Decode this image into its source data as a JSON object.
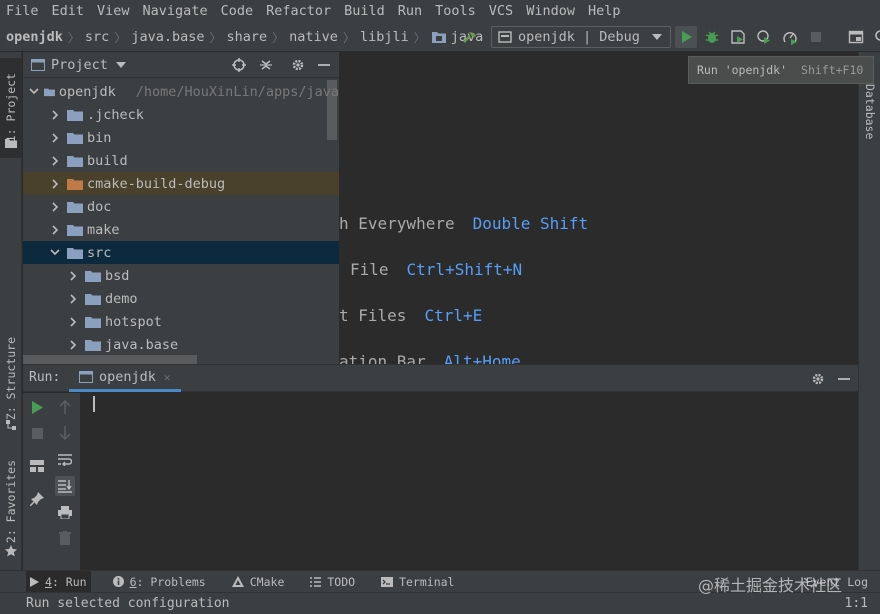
{
  "colors": {
    "accent": "#4a88c7",
    "run_green": "#499c54",
    "shortcut_blue": "#589df6",
    "selection": "#0d293e"
  },
  "menu": [
    "File",
    "Edit",
    "View",
    "Navigate",
    "Code",
    "Refactor",
    "Build",
    "Run",
    "Tools",
    "VCS",
    "Window",
    "Help"
  ],
  "breadcrumbs": [
    "openjdk",
    "src",
    "java.base",
    "share",
    "native",
    "libjli",
    "java"
  ],
  "toolbar": {
    "run_config": "openjdk | Debug"
  },
  "tooltip": {
    "text": "Run 'openjdk'",
    "shortcut": "Shift+F10"
  },
  "left_strip": {
    "project_tab": "1: Project",
    "structure_tab": "Z: Structure",
    "favorites_tab": "2: Favorites"
  },
  "right_strip": {
    "database_tab": "Database"
  },
  "project": {
    "title": "Project",
    "root": {
      "label": "openjdk",
      "path": "/home/HouXinLin/apps/java"
    },
    "items": [
      {
        "label": ".jcheck"
      },
      {
        "label": "bin"
      },
      {
        "label": "build"
      },
      {
        "label": "cmake-build-debug"
      },
      {
        "label": "doc"
      },
      {
        "label": "make"
      },
      {
        "label": "src"
      },
      {
        "label": "bsd"
      },
      {
        "label": "demo"
      },
      {
        "label": "hotspot"
      },
      {
        "label": "java.base"
      }
    ]
  },
  "editor_hints": [
    {
      "label": "h Everywhere",
      "key": "Double Shift"
    },
    {
      "label": "File",
      "key": "Ctrl+Shift+N"
    },
    {
      "label": "t Files",
      "key": "Ctrl+E"
    },
    {
      "label": "ation Bar",
      "key": "Alt+Home"
    }
  ],
  "run_panel": {
    "label": "Run:",
    "tab": "openjdk"
  },
  "bottom_tabs": [
    {
      "num": "4",
      "label": ": Run"
    },
    {
      "num": "6",
      "label": ": Problems"
    },
    {
      "num": "",
      "label": "CMake"
    },
    {
      "num": "",
      "label": "TODO"
    },
    {
      "num": "",
      "label": "Terminal"
    }
  ],
  "event_log": "Event Log",
  "status": {
    "message": "Run selected configuration",
    "position": "1:1"
  },
  "watermark": "@稀土掘金技术社区"
}
